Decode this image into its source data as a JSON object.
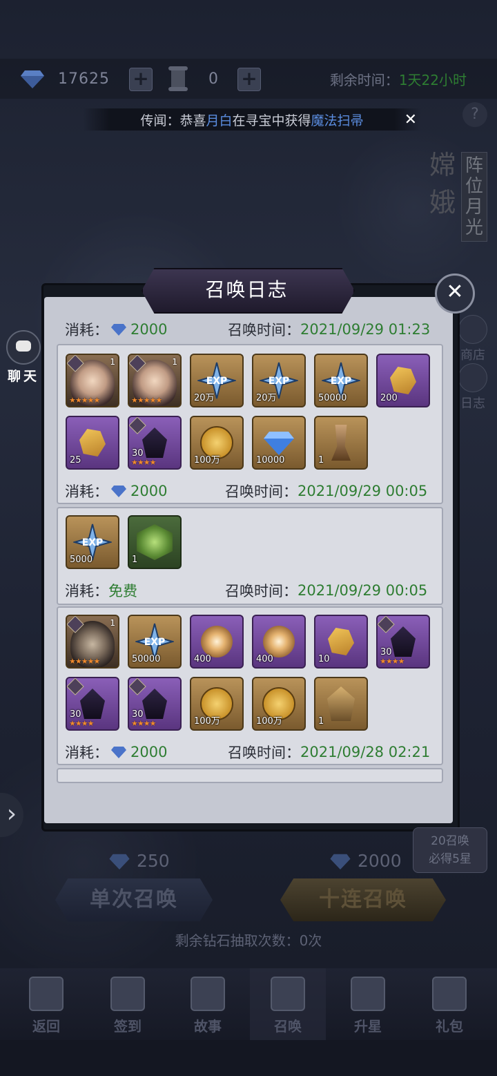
{
  "resources": {
    "diamond_count": "17625",
    "scroll_count": "0",
    "remaining_label": "剩余时间：",
    "remaining_value": "1天22小时"
  },
  "rumor": {
    "prefix": "传闻：恭喜",
    "player": "月白",
    "middle": "在寻宝中获得",
    "item": "魔法扫帚"
  },
  "side": {
    "title_vertical": "嫦娥",
    "tag_vertical": "阵位月光",
    "shop": "商店",
    "log": "日志",
    "chat": "聊天"
  },
  "dialog": {
    "title": "召唤日志",
    "cost_label": "消耗：",
    "time_label": "召唤时间：",
    "entries": [
      {
        "cost": "2000",
        "time": "2021/09/29 01:23"
      },
      {
        "cost": "2000",
        "time": "2021/09/29 00:05"
      },
      {
        "cost": "免费",
        "time": "2021/09/29 00:05"
      },
      {
        "cost": "2000",
        "time": "2021/09/28 02:21"
      }
    ],
    "group1_items": [
      {
        "type": "hero",
        "qty": "",
        "lvl": "1",
        "stars": "★★★★★"
      },
      {
        "type": "hero",
        "qty": "",
        "lvl": "1",
        "stars": "★★★★★"
      },
      {
        "type": "exp",
        "qty": "20万"
      },
      {
        "type": "exp",
        "qty": "20万"
      },
      {
        "type": "exp",
        "qty": "50000"
      },
      {
        "type": "rune",
        "qty": "200"
      },
      {
        "type": "rune",
        "qty": "25"
      },
      {
        "type": "hood",
        "qty": "30",
        "stars": "★★★★"
      },
      {
        "type": "coin",
        "qty": "100万"
      },
      {
        "type": "diamond",
        "qty": "10000"
      },
      {
        "type": "statue",
        "qty": "1"
      }
    ],
    "group2_items": [
      {
        "type": "exp",
        "qty": "5000"
      },
      {
        "type": "emblem",
        "qty": "1"
      }
    ],
    "group3_items": [
      {
        "type": "hero",
        "qty": "",
        "lvl": "1",
        "stars": "★★★★★"
      },
      {
        "type": "exp",
        "qty": "50000"
      },
      {
        "type": "swirl",
        "qty": "400"
      },
      {
        "type": "swirl",
        "qty": "400"
      },
      {
        "type": "rune",
        "qty": "10"
      },
      {
        "type": "hood",
        "qty": "30",
        "stars": "★★★★"
      },
      {
        "type": "hood",
        "qty": "30",
        "stars": "★★★★"
      },
      {
        "type": "hood",
        "qty": "30",
        "stars": "★★★★"
      },
      {
        "type": "coin",
        "qty": "100万"
      },
      {
        "type": "coin",
        "qty": "100万"
      },
      {
        "type": "helm",
        "qty": "1"
      }
    ]
  },
  "summon": {
    "single_cost": "250",
    "ten_cost": "2000",
    "single_label": "单次召唤",
    "ten_label": "十连召唤",
    "guarantee_line1": "20召唤",
    "guarantee_line2": "必得5星",
    "remaining_draws": "剩余钻石抽取次数：0次"
  },
  "nav": {
    "back": "返回",
    "checkin": "签到",
    "story": "故事",
    "summon": "召唤",
    "upgrade": "升星",
    "gift": "礼包"
  },
  "colors": {
    "green_text": "#2e7d32",
    "highlight_blue": "#5b8de0",
    "gold_frame": "#b9935a",
    "purple_frame": "#8a5fb8"
  }
}
